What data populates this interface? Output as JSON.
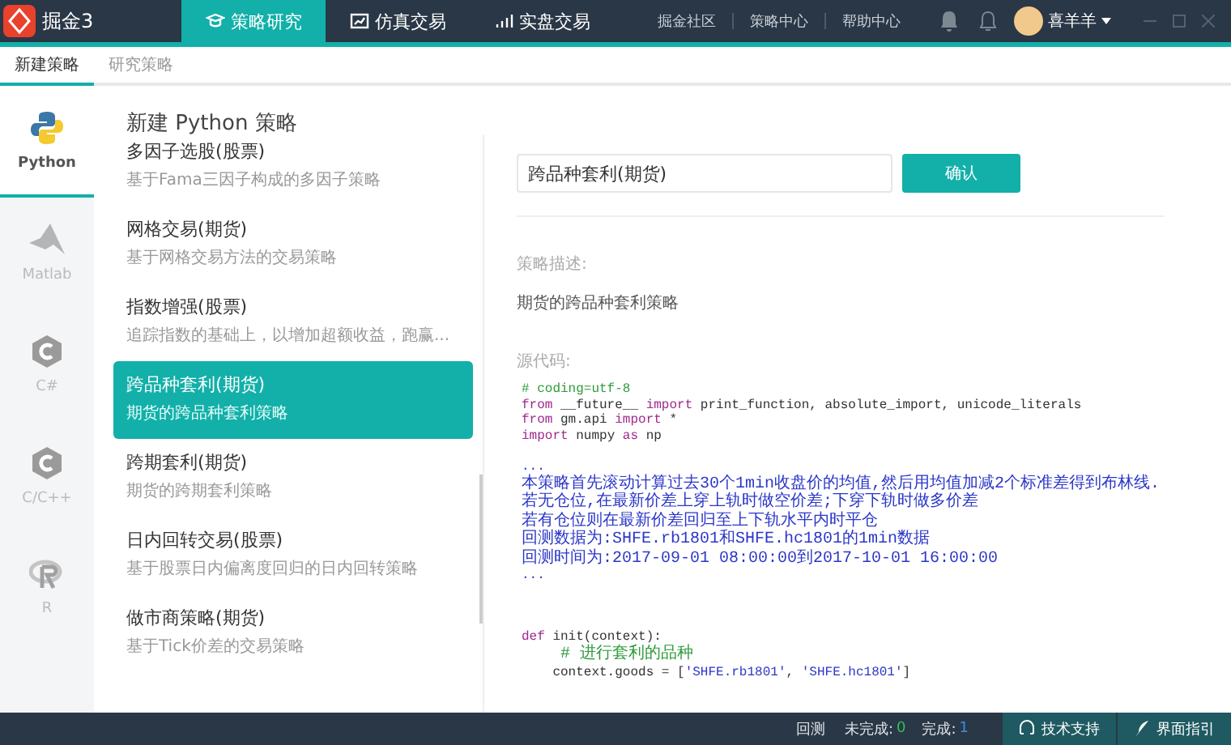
{
  "app": {
    "name": "掘金3"
  },
  "nav_tabs": [
    {
      "label": "策略研究",
      "selected": true
    },
    {
      "label": "仿真交易",
      "selected": false
    },
    {
      "label": "实盘交易",
      "selected": false
    }
  ],
  "top_links": [
    "掘金社区",
    "策略中心",
    "帮助中心"
  ],
  "user": {
    "name": "喜羊羊"
  },
  "sub_tabs": [
    {
      "label": "新建策略",
      "selected": true
    },
    {
      "label": "研究策略",
      "selected": false
    }
  ],
  "languages": [
    {
      "label": "Python",
      "selected": true,
      "kind": "python"
    },
    {
      "label": "Matlab",
      "selected": false,
      "kind": "matlab"
    },
    {
      "label": "C#",
      "selected": false,
      "kind": "csharp"
    },
    {
      "label": "C/C++",
      "selected": false,
      "kind": "cpp"
    },
    {
      "label": "R",
      "selected": false,
      "kind": "r"
    }
  ],
  "page_title": "新建 Python 策略",
  "templates": [
    {
      "title": "多因子选股(股票)",
      "desc": "基于Fama三因子构成的多因子策略",
      "selected": false
    },
    {
      "title": "网格交易(期货)",
      "desc": "基于网格交易方法的交易策略",
      "selected": false
    },
    {
      "title": "指数增强(股票)",
      "desc": "追踪指数的基础上，以增加超额收益，跑赢...",
      "selected": false
    },
    {
      "title": "跨品种套利(期货)",
      "desc": "期货的跨品种套利策略",
      "selected": true
    },
    {
      "title": "跨期套利(期货)",
      "desc": "期货的跨期套利策略",
      "selected": false
    },
    {
      "title": "日内回转交易(股票)",
      "desc": "基于股票日内偏离度回归的日内回转策略",
      "selected": false
    },
    {
      "title": "做市商策略(期货)",
      "desc": "基于Tick价差的交易策略",
      "selected": false
    }
  ],
  "name_field": {
    "value": "跨品种套利(期货)"
  },
  "confirm_button": "确认",
  "description_label": "策略描述:",
  "description": "期货的跨品种套利策略",
  "source_label": "源代码:",
  "code_lines": [
    {
      "kind": "code",
      "tokens": [
        {
          "t": "# coding=utf-8",
          "kind": "comment"
        }
      ]
    },
    {
      "kind": "code",
      "tokens": [
        {
          "t": "from",
          "kind": "keyword"
        },
        {
          "t": " __future__ ",
          "kind": "plain"
        },
        {
          "t": "import",
          "kind": "keyword"
        },
        {
          "t": " print_function, absolute_import, unicode_literals",
          "kind": "plain"
        }
      ]
    },
    {
      "kind": "code",
      "tokens": [
        {
          "t": "from",
          "kind": "keyword"
        },
        {
          "t": " gm.api ",
          "kind": "plain"
        },
        {
          "t": "import",
          "kind": "keyword"
        },
        {
          "t": " *",
          "kind": "plain"
        }
      ]
    },
    {
      "kind": "code",
      "tokens": [
        {
          "t": "import",
          "kind": "keyword"
        },
        {
          "t": " numpy ",
          "kind": "plain"
        },
        {
          "t": "as",
          "kind": "keyword"
        },
        {
          "t": " np",
          "kind": "plain"
        }
      ]
    },
    {
      "kind": "blank"
    },
    {
      "kind": "code",
      "tokens": [
        {
          "t": "...",
          "kind": "string"
        }
      ]
    },
    {
      "kind": "doc",
      "tokens": [
        {
          "t": "本策略首先滚动计算过去30个1min收盘价的均值,然后用均值加减2个标准差得到布林线.",
          "kind": "string"
        }
      ]
    },
    {
      "kind": "doc",
      "tokens": [
        {
          "t": "若无仓位,在最新价差上穿上轨时做空价差;下穿下轨时做多价差",
          "kind": "string"
        }
      ]
    },
    {
      "kind": "doc",
      "tokens": [
        {
          "t": "若有仓位则在最新价差回归至上下轨水平内时平仓",
          "kind": "string"
        }
      ]
    },
    {
      "kind": "doc",
      "tokens": [
        {
          "t": "回测数据为:SHFE.rb1801和SHFE.hc1801的1min数据",
          "kind": "string"
        }
      ]
    },
    {
      "kind": "doc",
      "tokens": [
        {
          "t": "回测时间为:2017-09-01 08:00:00到2017-10-01 16:00:00",
          "kind": "string"
        }
      ]
    },
    {
      "kind": "code",
      "tokens": [
        {
          "t": "...",
          "kind": "string"
        }
      ]
    },
    {
      "kind": "blank"
    },
    {
      "kind": "blank"
    },
    {
      "kind": "blank"
    },
    {
      "kind": "code",
      "tokens": [
        {
          "t": "def",
          "kind": "keyword"
        },
        {
          "t": " init(context):",
          "kind": "plain"
        }
      ]
    },
    {
      "kind": "doc",
      "tokens": [
        {
          "t": "    # 进行套利的品种",
          "kind": "comment"
        }
      ]
    },
    {
      "kind": "code",
      "tokens": [
        {
          "t": "    context.goods = [",
          "kind": "plain"
        },
        {
          "t": "'SHFE.rb1801'",
          "kind": "string"
        },
        {
          "t": ", ",
          "kind": "plain"
        },
        {
          "t": "'SHFE.hc1801'",
          "kind": "string"
        },
        {
          "t": "]",
          "kind": "plain"
        }
      ]
    }
  ],
  "status": {
    "mode": "回测",
    "pending_label": "未完成:",
    "pending": "0",
    "done_label": "完成:",
    "done": "1",
    "support": "技术支持",
    "guide": "界面指引"
  }
}
